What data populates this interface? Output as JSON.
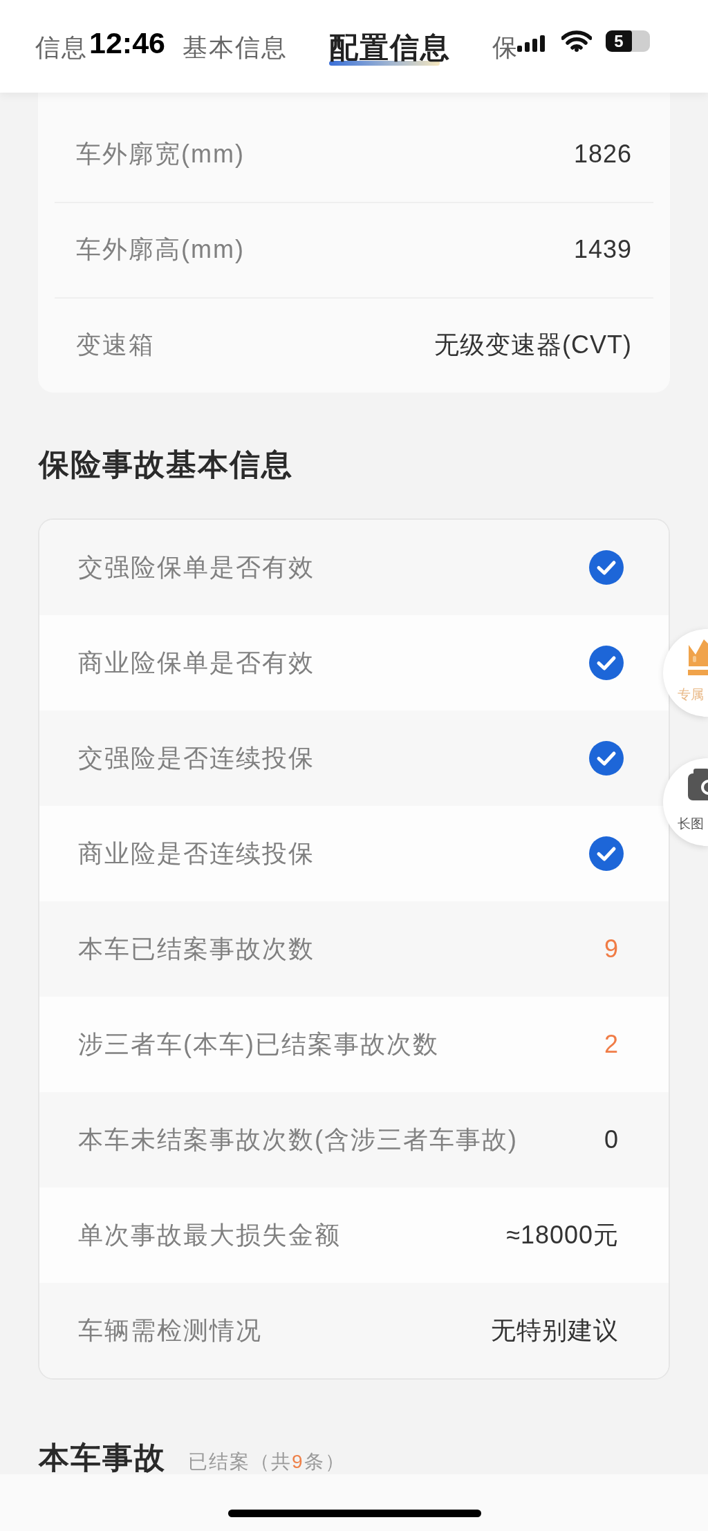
{
  "status_bar": {
    "time": "12:46",
    "battery": "5"
  },
  "tabs": [
    {
      "label": "信息",
      "selected": false
    },
    {
      "label": "基本信息",
      "selected": false
    },
    {
      "label": "配置信息",
      "selected": true
    },
    {
      "label": "保",
      "selected": false
    }
  ],
  "config_card": {
    "rows": [
      {
        "label": "车外廓宽(mm)",
        "value": "1826"
      },
      {
        "label": "车外廓高(mm)",
        "value": "1439"
      },
      {
        "label": "变速箱",
        "value": "无级变速器(CVT)"
      }
    ]
  },
  "insurance_section": {
    "title": "保险事故基本信息",
    "rows": [
      {
        "kind": "check",
        "label": "交强险保单是否有效",
        "checked": true
      },
      {
        "kind": "check",
        "label": "商业险保单是否有效",
        "checked": true
      },
      {
        "kind": "check",
        "label": "交强险是否连续投保",
        "checked": true
      },
      {
        "kind": "check",
        "label": "商业险是否连续投保",
        "checked": true
      },
      {
        "kind": "text",
        "label": "本车已结案事故次数",
        "value": "9",
        "highlighted": true
      },
      {
        "kind": "text",
        "label": "涉三者车(本车)已结案事故次数",
        "value": "2",
        "highlighted": true
      },
      {
        "kind": "text",
        "label": "本车未结案事故次数(含涉三者车事故)",
        "value": "0",
        "highlighted": false
      },
      {
        "kind": "text",
        "label": "单次事故最大损失金额",
        "value": "≈18000元",
        "highlighted": false
      },
      {
        "kind": "text",
        "label": "车辆需检测情况",
        "value": "无特别建议",
        "highlighted": false
      }
    ]
  },
  "accident_section": {
    "title": "本车事故",
    "note_parts": [
      {
        "text": "已结案（共",
        "highlighted": false
      },
      {
        "text": "9",
        "highlighted": true
      },
      {
        "text": "条）",
        "highlighted": false
      }
    ]
  },
  "floating_buttons": [
    {
      "kind": "vip",
      "label": "专属"
    },
    {
      "kind": "screenshot",
      "label": "长图"
    }
  ]
}
